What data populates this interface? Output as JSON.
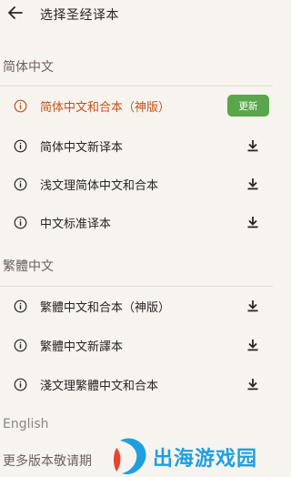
{
  "header": {
    "title": "选择圣经译本",
    "back_icon": "arrow-left-icon"
  },
  "colors": {
    "selected_text": "#c0531c",
    "update_button_bg": "#5aa64a",
    "background": "#f7f3ef"
  },
  "sections": {
    "simplified": {
      "title": "简体中文",
      "items": [
        {
          "label": "简体中文和合本（神版）",
          "selected": true,
          "action": "更新"
        },
        {
          "label": "简体中文新译本",
          "selected": false,
          "action": "download-icon"
        },
        {
          "label": "浅文理简体中文和合本",
          "selected": false,
          "action": "download-icon"
        },
        {
          "label": "中文标准译本",
          "selected": false,
          "action": "download-icon"
        }
      ]
    },
    "traditional": {
      "title": "繁體中文",
      "items": [
        {
          "label": "繁體中文和合本（神版）",
          "action": "download-icon"
        },
        {
          "label": "繁體中文新譯本",
          "action": "download-icon"
        },
        {
          "label": "淺文理繁體中文和合本",
          "action": "download-icon"
        }
      ]
    },
    "english": {
      "title": "English"
    }
  },
  "footer": {
    "more_text": "更多版本敬请期"
  },
  "watermark": {
    "text": "出海游戏园"
  }
}
